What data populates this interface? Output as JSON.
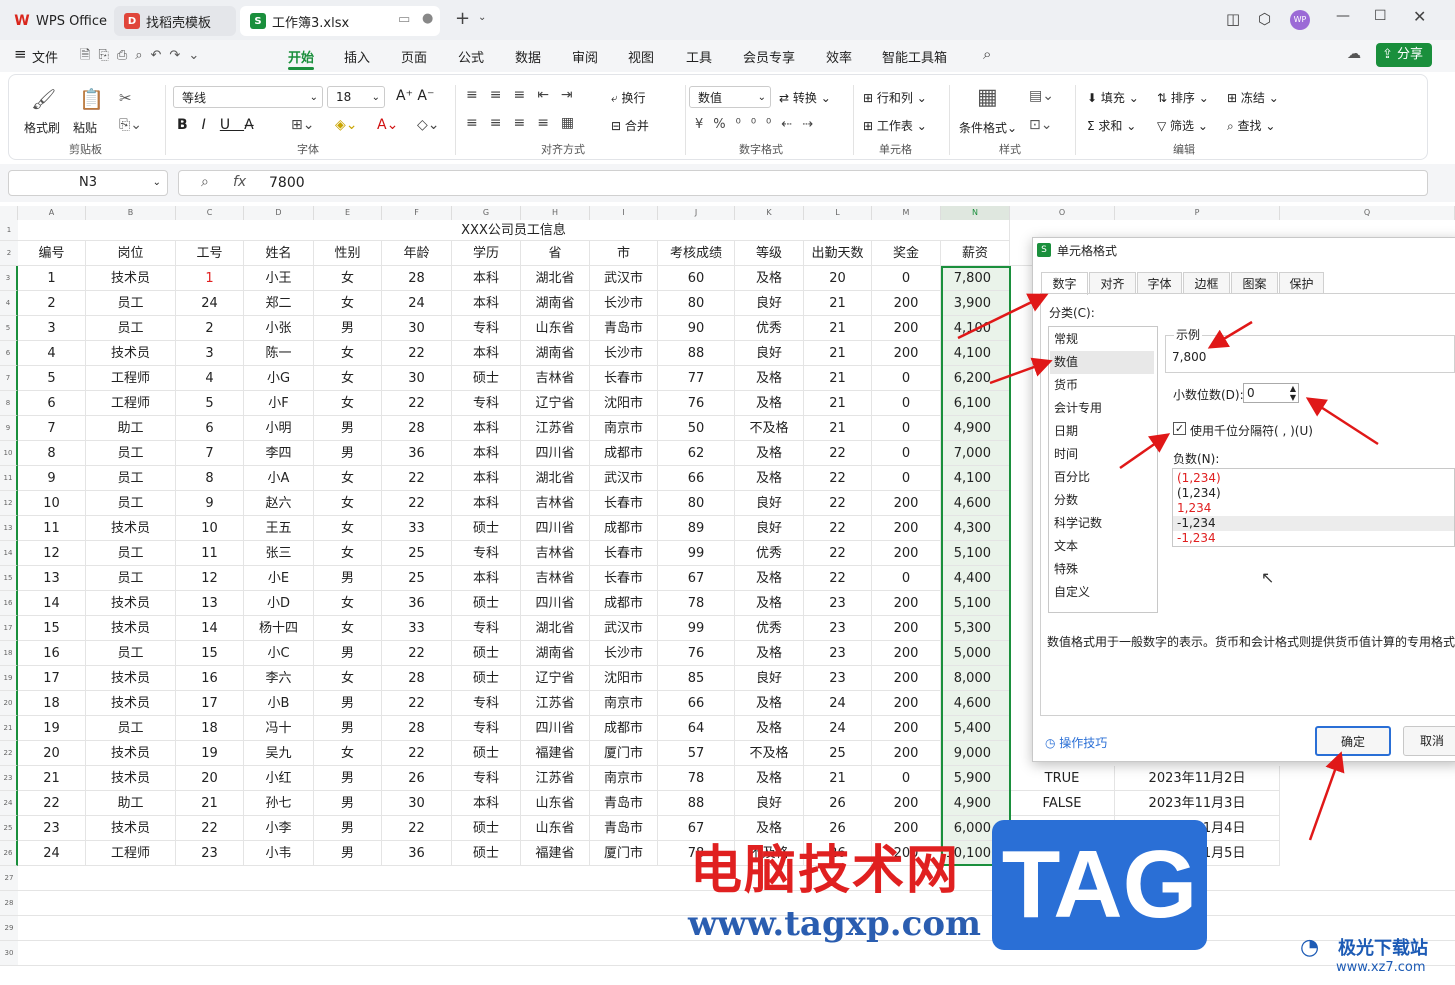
{
  "tabs": [
    {
      "label": "WPS Office"
    },
    {
      "label": "找稻壳模板"
    },
    {
      "label": "工作簿3.xlsx"
    }
  ],
  "avatar": "WP",
  "menu": {
    "file": "文件",
    "items": [
      "开始",
      "插入",
      "页面",
      "公式",
      "数据",
      "审阅",
      "视图",
      "工具",
      "会员专享",
      "效率",
      "智能工具箱"
    ],
    "share": "分享"
  },
  "ribbon": {
    "format_painter": "格式刷",
    "paste": "粘贴",
    "clipboard": "剪贴板",
    "font_name": "等线",
    "font_size": "18",
    "font_group": "字体",
    "wrap": "换行",
    "merge": "合并",
    "align_group": "对齐方式",
    "num_format": "数值",
    "convert": "转换",
    "num_group": "数字格式",
    "row_col": "行和列",
    "worksheet": "工作表",
    "cell_group": "单元格",
    "cond_format": "条件格式",
    "style_group": "样式",
    "fill": "填充",
    "sort": "排序",
    "freeze": "冻结",
    "sum": "求和",
    "filter": "筛选",
    "find": "查找",
    "edit_group": "编辑"
  },
  "formula": {
    "cell_ref": "N3",
    "fx": "fx",
    "value": "7800"
  },
  "sheet": {
    "columns": [
      "A",
      "B",
      "C",
      "D",
      "E",
      "F",
      "G",
      "H",
      "I",
      "J",
      "K",
      "L",
      "M",
      "N",
      "O",
      "P",
      "Q"
    ],
    "title": "XXX公司员工信息",
    "headers": [
      "编号",
      "岗位",
      "工号",
      "姓名",
      "性别",
      "年龄",
      "学历",
      "省",
      "市",
      "考核成绩",
      "等级",
      "出勤天数",
      "奖金",
      "薪资",
      "薪"
    ],
    "rows": [
      [
        "1",
        "技术员",
        "1",
        "小王",
        "女",
        "28",
        "本科",
        "湖北省",
        "武汉市",
        "60",
        "及格",
        "20",
        "0",
        "7,800"
      ],
      [
        "2",
        "员工",
        "24",
        "郑二",
        "女",
        "24",
        "本科",
        "湖南省",
        "长沙市",
        "80",
        "良好",
        "21",
        "200",
        "3,900"
      ],
      [
        "3",
        "员工",
        "2",
        "小张",
        "男",
        "30",
        "专科",
        "山东省",
        "青岛市",
        "90",
        "优秀",
        "21",
        "200",
        "4,100"
      ],
      [
        "4",
        "技术员",
        "3",
        "陈一",
        "女",
        "22",
        "本科",
        "湖南省",
        "长沙市",
        "88",
        "良好",
        "21",
        "200",
        "4,100"
      ],
      [
        "5",
        "工程师",
        "4",
        "小G",
        "女",
        "30",
        "硕士",
        "吉林省",
        "长春市",
        "77",
        "及格",
        "21",
        "0",
        "6,200"
      ],
      [
        "6",
        "工程师",
        "5",
        "小F",
        "女",
        "22",
        "专科",
        "辽宁省",
        "沈阳市",
        "76",
        "及格",
        "21",
        "0",
        "6,100"
      ],
      [
        "7",
        "助工",
        "6",
        "小明",
        "男",
        "28",
        "本科",
        "江苏省",
        "南京市",
        "50",
        "不及格",
        "21",
        "0",
        "4,900"
      ],
      [
        "8",
        "员工",
        "7",
        "李四",
        "男",
        "36",
        "本科",
        "四川省",
        "成都市",
        "62",
        "及格",
        "22",
        "0",
        "7,000"
      ],
      [
        "9",
        "员工",
        "8",
        "小A",
        "女",
        "22",
        "本科",
        "湖北省",
        "武汉市",
        "66",
        "及格",
        "22",
        "0",
        "4,100"
      ],
      [
        "10",
        "员工",
        "9",
        "赵六",
        "女",
        "22",
        "本科",
        "吉林省",
        "长春市",
        "80",
        "良好",
        "22",
        "200",
        "4,600"
      ],
      [
        "11",
        "技术员",
        "10",
        "王五",
        "女",
        "33",
        "硕士",
        "四川省",
        "成都市",
        "89",
        "良好",
        "22",
        "200",
        "4,300"
      ],
      [
        "12",
        "员工",
        "11",
        "张三",
        "女",
        "25",
        "专科",
        "吉林省",
        "长春市",
        "99",
        "优秀",
        "22",
        "200",
        "5,100"
      ],
      [
        "13",
        "员工",
        "12",
        "小E",
        "男",
        "25",
        "本科",
        "吉林省",
        "长春市",
        "67",
        "及格",
        "22",
        "0",
        "4,400"
      ],
      [
        "14",
        "技术员",
        "13",
        "小D",
        "女",
        "36",
        "硕士",
        "四川省",
        "成都市",
        "78",
        "及格",
        "23",
        "200",
        "5,100"
      ],
      [
        "15",
        "技术员",
        "14",
        "杨十四",
        "女",
        "33",
        "专科",
        "湖北省",
        "武汉市",
        "99",
        "优秀",
        "23",
        "200",
        "5,300"
      ],
      [
        "16",
        "员工",
        "15",
        "小C",
        "男",
        "22",
        "硕士",
        "湖南省",
        "长沙市",
        "76",
        "及格",
        "23",
        "200",
        "5,000"
      ],
      [
        "17",
        "技术员",
        "16",
        "李六",
        "女",
        "28",
        "硕士",
        "辽宁省",
        "沈阳市",
        "85",
        "良好",
        "23",
        "200",
        "8,000"
      ],
      [
        "18",
        "技术员",
        "17",
        "小B",
        "男",
        "22",
        "专科",
        "江苏省",
        "南京市",
        "66",
        "及格",
        "24",
        "200",
        "4,600"
      ],
      [
        "19",
        "员工",
        "18",
        "冯十",
        "男",
        "28",
        "专科",
        "四川省",
        "成都市",
        "64",
        "及格",
        "24",
        "200",
        "5,400"
      ],
      [
        "20",
        "技术员",
        "19",
        "吴九",
        "女",
        "22",
        "硕士",
        "福建省",
        "厦门市",
        "57",
        "不及格",
        "25",
        "200",
        "9,000"
      ],
      [
        "21",
        "技术员",
        "20",
        "小红",
        "男",
        "26",
        "专科",
        "江苏省",
        "南京市",
        "78",
        "及格",
        "21",
        "0",
        "5,900"
      ],
      [
        "22",
        "助工",
        "21",
        "孙七",
        "男",
        "30",
        "本科",
        "山东省",
        "青岛市",
        "88",
        "良好",
        "26",
        "200",
        "4,900"
      ],
      [
        "23",
        "技术员",
        "22",
        "小李",
        "男",
        "22",
        "硕士",
        "山东省",
        "青岛市",
        "67",
        "及格",
        "26",
        "200",
        "6,000"
      ],
      [
        "24",
        "工程师",
        "23",
        "小韦",
        "男",
        "36",
        "硕士",
        "福建省",
        "厦门市",
        "78",
        "不及格",
        "26",
        "200",
        "10,100"
      ]
    ],
    "extra": [
      {
        "row": 21,
        "o": "TRUE",
        "p": "2023年11月2日"
      },
      {
        "row": 22,
        "o": "FALSE",
        "p": "2023年11月3日"
      },
      {
        "row": 23,
        "o": "TRUE",
        "p": "2023年11月4日"
      },
      {
        "row": 24,
        "o": "TRUE",
        "p": "2023年11月5日"
      }
    ],
    "row_numbers": [
      "1",
      "2",
      "3",
      "4",
      "5",
      "6",
      "7",
      "8",
      "9",
      "10",
      "11",
      "12",
      "13",
      "14",
      "15",
      "16",
      "17",
      "18",
      "19",
      "20",
      "21",
      "22",
      "23",
      "24",
      "25",
      "26",
      "27",
      "28",
      "29",
      "30"
    ]
  },
  "dialog": {
    "title": "单元格格式",
    "tabs": [
      "数字",
      "对齐",
      "字体",
      "边框",
      "图案",
      "保护"
    ],
    "category_label": "分类(C):",
    "categories": [
      "常规",
      "数值",
      "货币",
      "会计专用",
      "日期",
      "时间",
      "百分比",
      "分数",
      "科学记数",
      "文本",
      "特殊",
      "自定义"
    ],
    "selected_category": "数值",
    "sample_label": "示例",
    "sample_value": "7,800",
    "decimals_label": "小数位数(D):",
    "decimals_value": "0",
    "thousands_label": "使用千位分隔符( , )(U)",
    "negative_label": "负数(N):",
    "negatives": [
      "(1,234)",
      "(1,234)",
      "1,234",
      "-1,234",
      "-1,234"
    ],
    "description": "数值格式用于一般数字的表示。货币和会计格式则提供货币值计算的专用格式。",
    "tips": "操作技巧",
    "ok": "确定",
    "cancel": "取消"
  },
  "watermark": {
    "cn": "电脑技术网",
    "url": "www.tagxp.com",
    "tag": "TAG",
    "site": "极光下载站",
    "site_url": "www.xz7.com"
  },
  "colors": {
    "accent": "#1a8f3c",
    "red": "#e02020",
    "arrow": "#e01818"
  }
}
